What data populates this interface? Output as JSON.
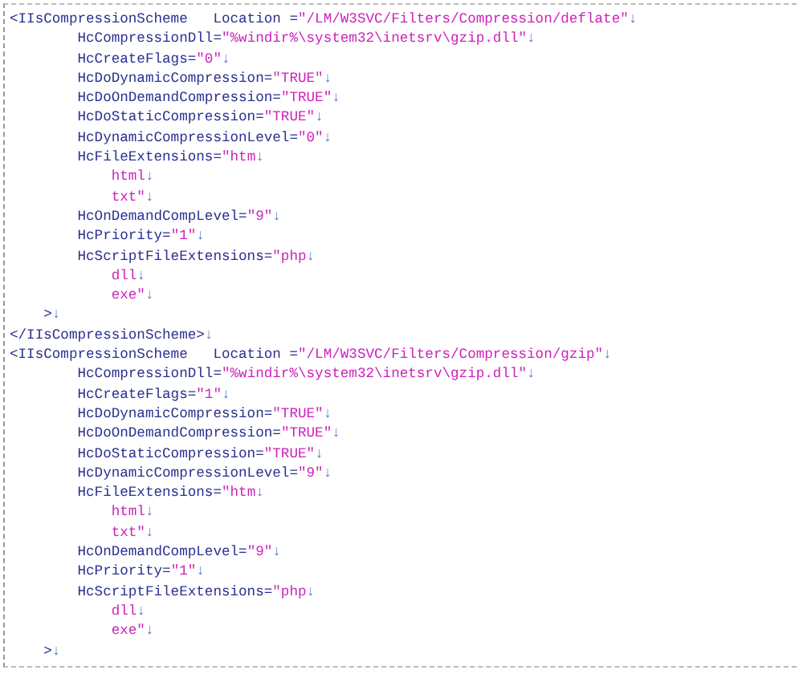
{
  "editor": {
    "lines": [
      {
        "segments": [
          {
            "kind": "name",
            "text": "<IIsCompressionScheme   Location ="
          },
          {
            "kind": "value",
            "text": "\"/LM/W3SVC/Filters/Compression/deflate\""
          },
          {
            "kind": "eol",
            "text": "↓"
          }
        ]
      },
      {
        "segments": [
          {
            "kind": "name",
            "text": "        HcCompressionDll="
          },
          {
            "kind": "value",
            "text": "\"%windir%\\system32\\inetsrv\\gzip.dll\""
          },
          {
            "kind": "eol",
            "text": "↓"
          }
        ]
      },
      {
        "segments": [
          {
            "kind": "name",
            "text": "        HcCreateFlags="
          },
          {
            "kind": "value",
            "text": "\"0\""
          },
          {
            "kind": "eol",
            "text": "↓"
          }
        ]
      },
      {
        "segments": [
          {
            "kind": "name",
            "text": "        HcDoDynamicCompression="
          },
          {
            "kind": "value",
            "text": "\"TRUE\""
          },
          {
            "kind": "eol",
            "text": "↓"
          }
        ]
      },
      {
        "segments": [
          {
            "kind": "name",
            "text": "        HcDoOnDemandCompression="
          },
          {
            "kind": "value",
            "text": "\"TRUE\""
          },
          {
            "kind": "eol",
            "text": "↓"
          }
        ]
      },
      {
        "segments": [
          {
            "kind": "name",
            "text": "        HcDoStaticCompression="
          },
          {
            "kind": "value",
            "text": "\"TRUE\""
          },
          {
            "kind": "eol",
            "text": "↓"
          }
        ]
      },
      {
        "segments": [
          {
            "kind": "name",
            "text": "        HcDynamicCompressionLevel="
          },
          {
            "kind": "value",
            "text": "\"0\""
          },
          {
            "kind": "eol",
            "text": "↓"
          }
        ]
      },
      {
        "segments": [
          {
            "kind": "name",
            "text": "        HcFileExtensions="
          },
          {
            "kind": "value",
            "text": "\"htm"
          },
          {
            "kind": "eol",
            "text": "↓"
          }
        ]
      },
      {
        "segments": [
          {
            "kind": "value",
            "text": "            html"
          },
          {
            "kind": "eol",
            "text": "↓"
          }
        ]
      },
      {
        "segments": [
          {
            "kind": "value",
            "text": "            txt\""
          },
          {
            "kind": "eol",
            "text": "↓"
          }
        ]
      },
      {
        "segments": [
          {
            "kind": "name",
            "text": "        HcOnDemandCompLevel="
          },
          {
            "kind": "value",
            "text": "\"9\""
          },
          {
            "kind": "eol",
            "text": "↓"
          }
        ]
      },
      {
        "segments": [
          {
            "kind": "name",
            "text": "        HcPriority="
          },
          {
            "kind": "value",
            "text": "\"1\""
          },
          {
            "kind": "eol",
            "text": "↓"
          }
        ]
      },
      {
        "segments": [
          {
            "kind": "name",
            "text": "        HcScriptFileExtensions="
          },
          {
            "kind": "value",
            "text": "\"php"
          },
          {
            "kind": "eol",
            "text": "↓"
          }
        ]
      },
      {
        "segments": [
          {
            "kind": "value",
            "text": "            dll"
          },
          {
            "kind": "eol",
            "text": "↓"
          }
        ]
      },
      {
        "segments": [
          {
            "kind": "value",
            "text": "            exe\""
          },
          {
            "kind": "eol",
            "text": "↓"
          }
        ]
      },
      {
        "segments": [
          {
            "kind": "name",
            "text": "    >"
          },
          {
            "kind": "eol",
            "text": "↓"
          }
        ]
      },
      {
        "segments": [
          {
            "kind": "name",
            "text": "</IIsCompressionScheme>"
          },
          {
            "kind": "eol",
            "text": "↓"
          }
        ]
      },
      {
        "segments": [
          {
            "kind": "name",
            "text": "<IIsCompressionScheme   Location ="
          },
          {
            "kind": "value",
            "text": "\"/LM/W3SVC/Filters/Compression/gzip\""
          },
          {
            "kind": "eol",
            "text": "↓"
          }
        ]
      },
      {
        "segments": [
          {
            "kind": "name",
            "text": "        HcCompressionDll="
          },
          {
            "kind": "value",
            "text": "\"%windir%\\system32\\inetsrv\\gzip.dll\""
          },
          {
            "kind": "eol",
            "text": "↓"
          }
        ]
      },
      {
        "segments": [
          {
            "kind": "name",
            "text": "        HcCreateFlags="
          },
          {
            "kind": "value",
            "text": "\"1\""
          },
          {
            "kind": "eol",
            "text": "↓"
          }
        ]
      },
      {
        "segments": [
          {
            "kind": "name",
            "text": "        HcDoDynamicCompression="
          },
          {
            "kind": "value",
            "text": "\"TRUE\""
          },
          {
            "kind": "eol",
            "text": "↓"
          }
        ]
      },
      {
        "segments": [
          {
            "kind": "name",
            "text": "        HcDoOnDemandCompression="
          },
          {
            "kind": "value",
            "text": "\"TRUE\""
          },
          {
            "kind": "eol",
            "text": "↓"
          }
        ]
      },
      {
        "segments": [
          {
            "kind": "name",
            "text": "        HcDoStaticCompression="
          },
          {
            "kind": "value",
            "text": "\"TRUE\""
          },
          {
            "kind": "eol",
            "text": "↓"
          }
        ]
      },
      {
        "segments": [
          {
            "kind": "name",
            "text": "        HcDynamicCompressionLevel="
          },
          {
            "kind": "value",
            "text": "\"9\""
          },
          {
            "kind": "eol",
            "text": "↓"
          }
        ]
      },
      {
        "segments": [
          {
            "kind": "name",
            "text": "        HcFileExtensions="
          },
          {
            "kind": "value",
            "text": "\"htm"
          },
          {
            "kind": "eol",
            "text": "↓"
          }
        ]
      },
      {
        "segments": [
          {
            "kind": "value",
            "text": "            html"
          },
          {
            "kind": "eol",
            "text": "↓"
          }
        ]
      },
      {
        "segments": [
          {
            "kind": "value",
            "text": "            txt\""
          },
          {
            "kind": "eol",
            "text": "↓"
          }
        ]
      },
      {
        "segments": [
          {
            "kind": "name",
            "text": "        HcOnDemandCompLevel="
          },
          {
            "kind": "value",
            "text": "\"9\""
          },
          {
            "kind": "eol",
            "text": "↓"
          }
        ]
      },
      {
        "segments": [
          {
            "kind": "name",
            "text": "        HcPriority="
          },
          {
            "kind": "value",
            "text": "\"1\""
          },
          {
            "kind": "eol",
            "text": "↓"
          }
        ]
      },
      {
        "segments": [
          {
            "kind": "name",
            "text": "        HcScriptFileExtensions="
          },
          {
            "kind": "value",
            "text": "\"php"
          },
          {
            "kind": "eol",
            "text": "↓"
          }
        ]
      },
      {
        "segments": [
          {
            "kind": "value",
            "text": "            dll"
          },
          {
            "kind": "eol",
            "text": "↓"
          }
        ]
      },
      {
        "segments": [
          {
            "kind": "value",
            "text": "            exe\""
          },
          {
            "kind": "eol",
            "text": "↓"
          }
        ]
      },
      {
        "segments": [
          {
            "kind": "name",
            "text": "    >"
          },
          {
            "kind": "eol",
            "text": "↓"
          }
        ]
      }
    ]
  }
}
